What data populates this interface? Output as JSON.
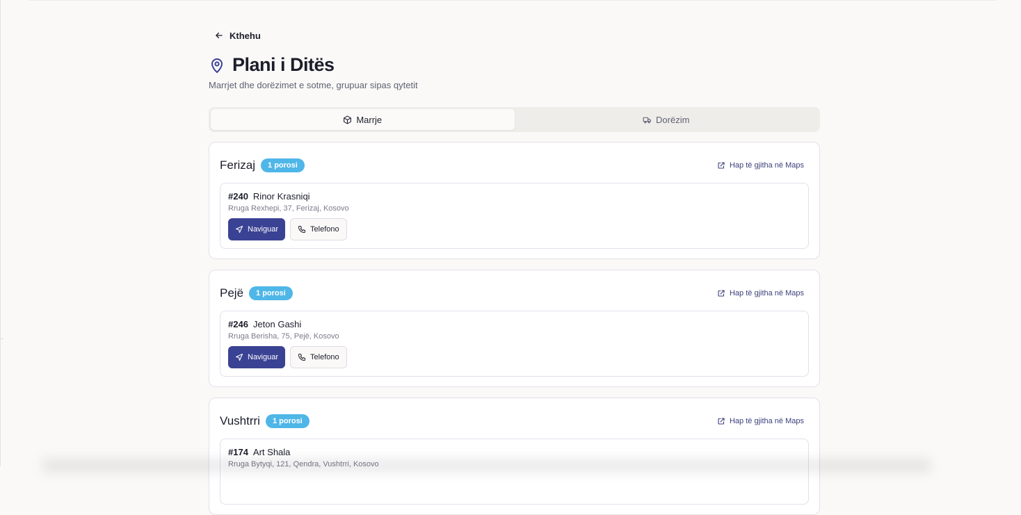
{
  "header": {
    "back_label": "Kthehu",
    "title": "Plani i Ditës",
    "subtitle": "Marrjet dhe dorëzimet e sotme, grupuar sipas qytetit"
  },
  "tabs": [
    {
      "label": "Marrje",
      "icon": "package-icon",
      "active": true
    },
    {
      "label": "Dorëzim",
      "icon": "truck-icon",
      "active": false
    }
  ],
  "maps_link_label": "Hap të gjitha në Maps",
  "navigate_label": "Naviguar",
  "phone_label": "Telefono",
  "cities": [
    {
      "name": "Ferizaj",
      "badge": "1 porosi",
      "orders": [
        {
          "id": "#240",
          "name": "Rinor Krasniqi",
          "address": "Rruga Rexhepi, 37, Ferizaj, Kosovo"
        }
      ]
    },
    {
      "name": "Pejë",
      "badge": "1 porosi",
      "orders": [
        {
          "id": "#246",
          "name": "Jeton Gashi",
          "address": "Rruga Berisha, 75, Pejë, Kosovo"
        }
      ]
    },
    {
      "name": "Vushtrri",
      "badge": "1 porosi",
      "orders": [
        {
          "id": "#174",
          "name": "Art Shala",
          "address": "Rruga Bytyqi, 121, Qendra, Vushtrri, Kosovo"
        }
      ]
    }
  ],
  "colors": {
    "accent": "#3a4294",
    "badge": "#4fb6e8",
    "background": "#faf9f7"
  }
}
